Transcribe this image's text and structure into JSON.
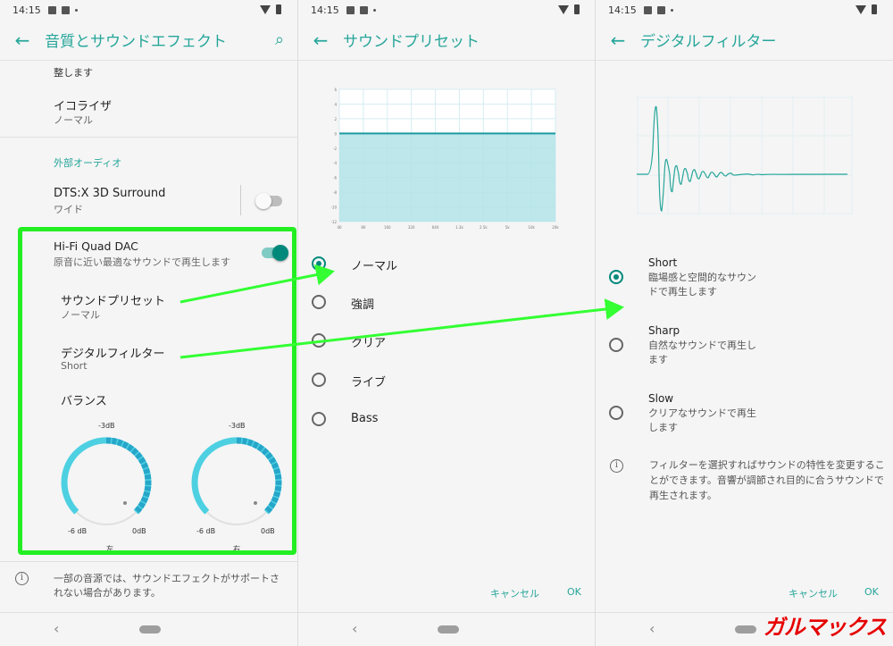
{
  "status": {
    "time": "14:15"
  },
  "panel1": {
    "title": "音質とサウンドエフェクト",
    "top_cut_text": "整します",
    "equalizer": {
      "label": "イコライザ",
      "value": "ノーマル"
    },
    "section_header": "外部オーディオ",
    "dts": {
      "label": "DTS:X 3D Surround",
      "value": "ワイド"
    },
    "hifi": {
      "label": "Hi-Fi Quad DAC",
      "desc": "原音に近い最適なサウンドで再生します"
    },
    "preset": {
      "label": "サウンドプリセット",
      "value": "ノーマル"
    },
    "filter": {
      "label": "デジタルフィルター",
      "value": "Short"
    },
    "balance": {
      "label": "バランス",
      "left": {
        "top": "-3dB",
        "min": "-6 dB",
        "max": "0dB",
        "name": "左"
      },
      "right": {
        "top": "-3dB",
        "min": "-6 dB",
        "max": "0dB",
        "name": "右"
      }
    },
    "footer_note": "一部の音源では、サウンドエフェクトがサポートされない場合があります。"
  },
  "panel2": {
    "title": "サウンドプリセット",
    "chart_data": {
      "type": "area",
      "x": [
        "40",
        "80",
        "160",
        "320",
        "640",
        "1.3k",
        "2.5k",
        "5k",
        "10k",
        "20k"
      ],
      "y_ticks": [
        "6",
        "4",
        "2",
        "0",
        "-2",
        "-4",
        "-6",
        "-8",
        "-10",
        "-12"
      ],
      "series": [
        {
          "values": [
            0,
            0,
            0,
            0,
            0,
            0,
            0,
            0,
            0,
            0
          ]
        }
      ],
      "ylim": [
        -12,
        6
      ],
      "grid": true
    },
    "options": [
      "ノーマル",
      "強調",
      "クリア",
      "ライブ",
      "Bass"
    ],
    "selected": 0,
    "cancel": "キャンセル",
    "ok": "OK"
  },
  "panel3": {
    "title": "デジタルフィルター",
    "options": [
      {
        "label": "Short",
        "desc": "臨場感と空間的なサウンドで再生します"
      },
      {
        "label": "Sharp",
        "desc": "自然なサウンドで再生します"
      },
      {
        "label": "Slow",
        "desc": "クリアなサウンドで再生します"
      }
    ],
    "selected": 0,
    "info": "フィルターを選択すればサウンドの特性を変更することができます。音響が調節され目的に合うサウンドで再生されます。",
    "cancel": "キャンセル",
    "ok": "OK"
  },
  "watermark": "ガルマックス",
  "colors": {
    "accent": "#26a69a",
    "highlight": "#22ee22",
    "chart_fill": "#b2e3e8"
  }
}
